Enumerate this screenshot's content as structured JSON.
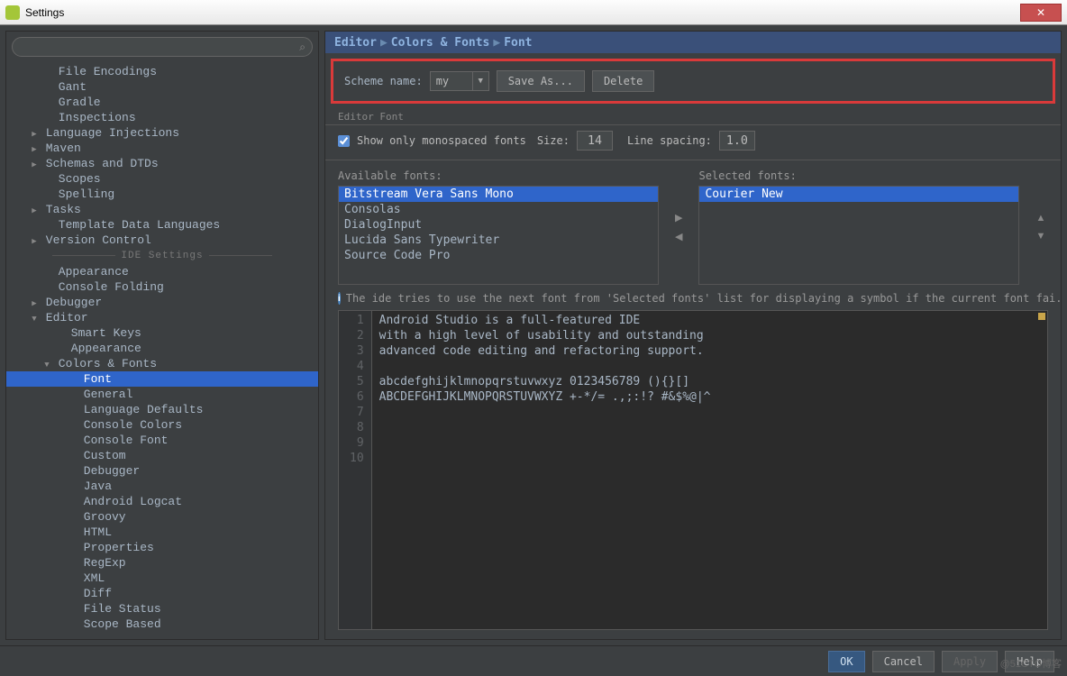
{
  "window": {
    "title": "Settings"
  },
  "sidebar": {
    "items": [
      {
        "label": "File Encodings",
        "indent": 2,
        "arrow": ""
      },
      {
        "label": "Gant",
        "indent": 2,
        "arrow": ""
      },
      {
        "label": "Gradle",
        "indent": 2,
        "arrow": ""
      },
      {
        "label": "Inspections",
        "indent": 2,
        "arrow": ""
      },
      {
        "label": "Language Injections",
        "indent": 1,
        "arrow": "▶"
      },
      {
        "label": "Maven",
        "indent": 1,
        "arrow": "▶"
      },
      {
        "label": "Schemas and DTDs",
        "indent": 1,
        "arrow": "▶"
      },
      {
        "label": "Scopes",
        "indent": 2,
        "arrow": ""
      },
      {
        "label": "Spelling",
        "indent": 2,
        "arrow": ""
      },
      {
        "label": "Tasks",
        "indent": 1,
        "arrow": "▶"
      },
      {
        "label": "Template Data Languages",
        "indent": 2,
        "arrow": ""
      },
      {
        "label": "Version Control",
        "indent": 1,
        "arrow": "▶"
      },
      {
        "label": "IDE Settings",
        "sep": true
      },
      {
        "label": "Appearance",
        "indent": 2,
        "arrow": ""
      },
      {
        "label": "Console Folding",
        "indent": 2,
        "arrow": ""
      },
      {
        "label": "Debugger",
        "indent": 1,
        "arrow": "▶"
      },
      {
        "label": "Editor",
        "indent": 1,
        "arrow": "▼"
      },
      {
        "label": "Smart Keys",
        "indent": 3,
        "arrow": ""
      },
      {
        "label": "Appearance",
        "indent": 3,
        "arrow": ""
      },
      {
        "label": "Colors & Fonts",
        "indent": 2,
        "arrow": "▼"
      },
      {
        "label": "Font",
        "indent": 4,
        "arrow": "",
        "selected": true
      },
      {
        "label": "General",
        "indent": 4,
        "arrow": ""
      },
      {
        "label": "Language Defaults",
        "indent": 4,
        "arrow": ""
      },
      {
        "label": "Console Colors",
        "indent": 4,
        "arrow": ""
      },
      {
        "label": "Console Font",
        "indent": 4,
        "arrow": ""
      },
      {
        "label": "Custom",
        "indent": 4,
        "arrow": ""
      },
      {
        "label": "Debugger",
        "indent": 4,
        "arrow": ""
      },
      {
        "label": "Java",
        "indent": 4,
        "arrow": ""
      },
      {
        "label": "Android Logcat",
        "indent": 4,
        "arrow": ""
      },
      {
        "label": "Groovy",
        "indent": 4,
        "arrow": ""
      },
      {
        "label": "HTML",
        "indent": 4,
        "arrow": ""
      },
      {
        "label": "Properties",
        "indent": 4,
        "arrow": ""
      },
      {
        "label": "RegExp",
        "indent": 4,
        "arrow": ""
      },
      {
        "label": "XML",
        "indent": 4,
        "arrow": ""
      },
      {
        "label": "Diff",
        "indent": 4,
        "arrow": ""
      },
      {
        "label": "File Status",
        "indent": 4,
        "arrow": ""
      },
      {
        "label": "Scope Based",
        "indent": 4,
        "arrow": ""
      }
    ]
  },
  "breadcrumb": {
    "p1": "Editor",
    "p2": "Colors & Fonts",
    "p3": "Font"
  },
  "scheme": {
    "label": "Scheme name:",
    "value": "my",
    "saveAs": "Save As...",
    "delete": "Delete"
  },
  "editorFont": {
    "title": "Editor Font",
    "showMono": "Show only monospaced fonts",
    "sizeLabel": "Size:",
    "size": "14",
    "lineSpacingLabel": "Line spacing:",
    "lineSpacing": "1.0"
  },
  "fonts": {
    "availLabel": "Available fonts:",
    "selLabel": "Selected fonts:",
    "available": [
      {
        "name": "Bitstream Vera Sans Mono",
        "sel": true
      },
      {
        "name": "Consolas"
      },
      {
        "name": "DialogInput"
      },
      {
        "name": "Lucida Sans Typewriter"
      },
      {
        "name": "Source Code Pro"
      }
    ],
    "selected": [
      {
        "name": "Courier New",
        "sel": true
      }
    ]
  },
  "info": "The ide tries to use the next font from 'Selected fonts' list for displaying a symbol if the current font fai...",
  "preview": {
    "lines": [
      "Android Studio is a full-featured IDE",
      "with a high level of usability and outstanding",
      "advanced code editing and refactoring support.",
      "",
      "abcdefghijklmnopqrstuvwxyz 0123456789 (){}[]",
      "ABCDEFGHIJKLMNOPQRSTUVWXYZ +-*/= .,;:!? #&$%@|^",
      "",
      "",
      "",
      ""
    ]
  },
  "footer": {
    "ok": "OK",
    "cancel": "Cancel",
    "apply": "Apply",
    "help": "Help"
  },
  "watermark": "@51CTO博客"
}
